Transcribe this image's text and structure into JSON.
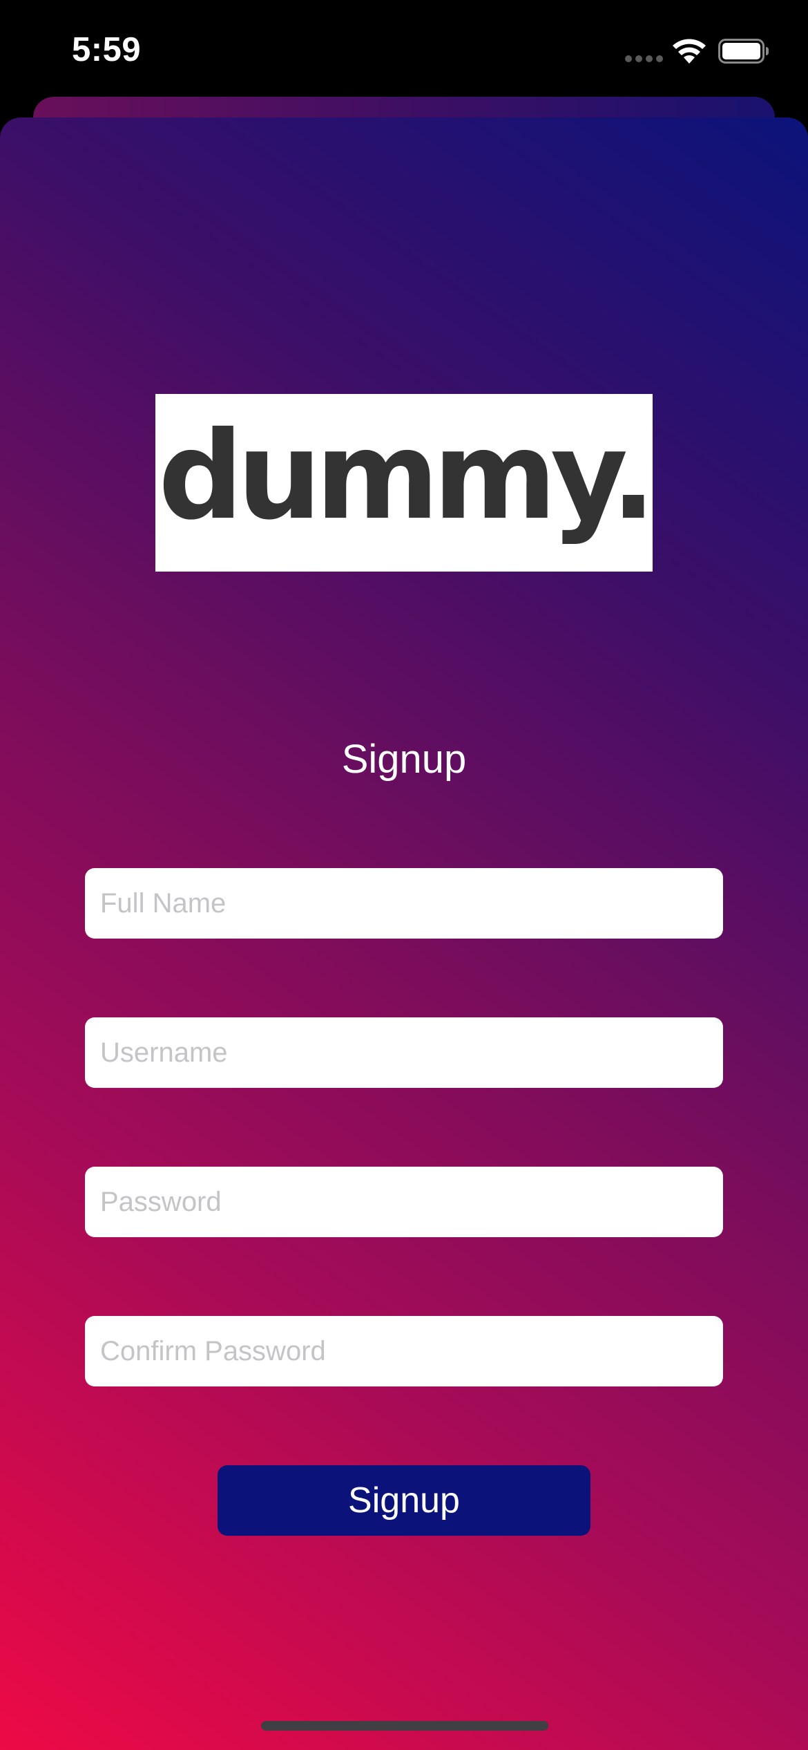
{
  "status_bar": {
    "time": "5:59"
  },
  "logo": {
    "text": "dummy."
  },
  "form": {
    "title": "Signup",
    "fields": [
      {
        "placeholder": "Full Name",
        "value": ""
      },
      {
        "placeholder": "Username",
        "value": ""
      },
      {
        "placeholder": "Password",
        "value": ""
      },
      {
        "placeholder": "Confirm Password",
        "value": ""
      }
    ],
    "submit_label": "Signup"
  },
  "colors": {
    "gradient_start": "#f00a45",
    "gradient_end": "#0b137a",
    "button_background": "#0b137a",
    "field_background": "#ffffff",
    "placeholder": "#c4c4c6"
  },
  "icons": [
    "signal-icon",
    "wifi-icon",
    "battery-icon"
  ]
}
